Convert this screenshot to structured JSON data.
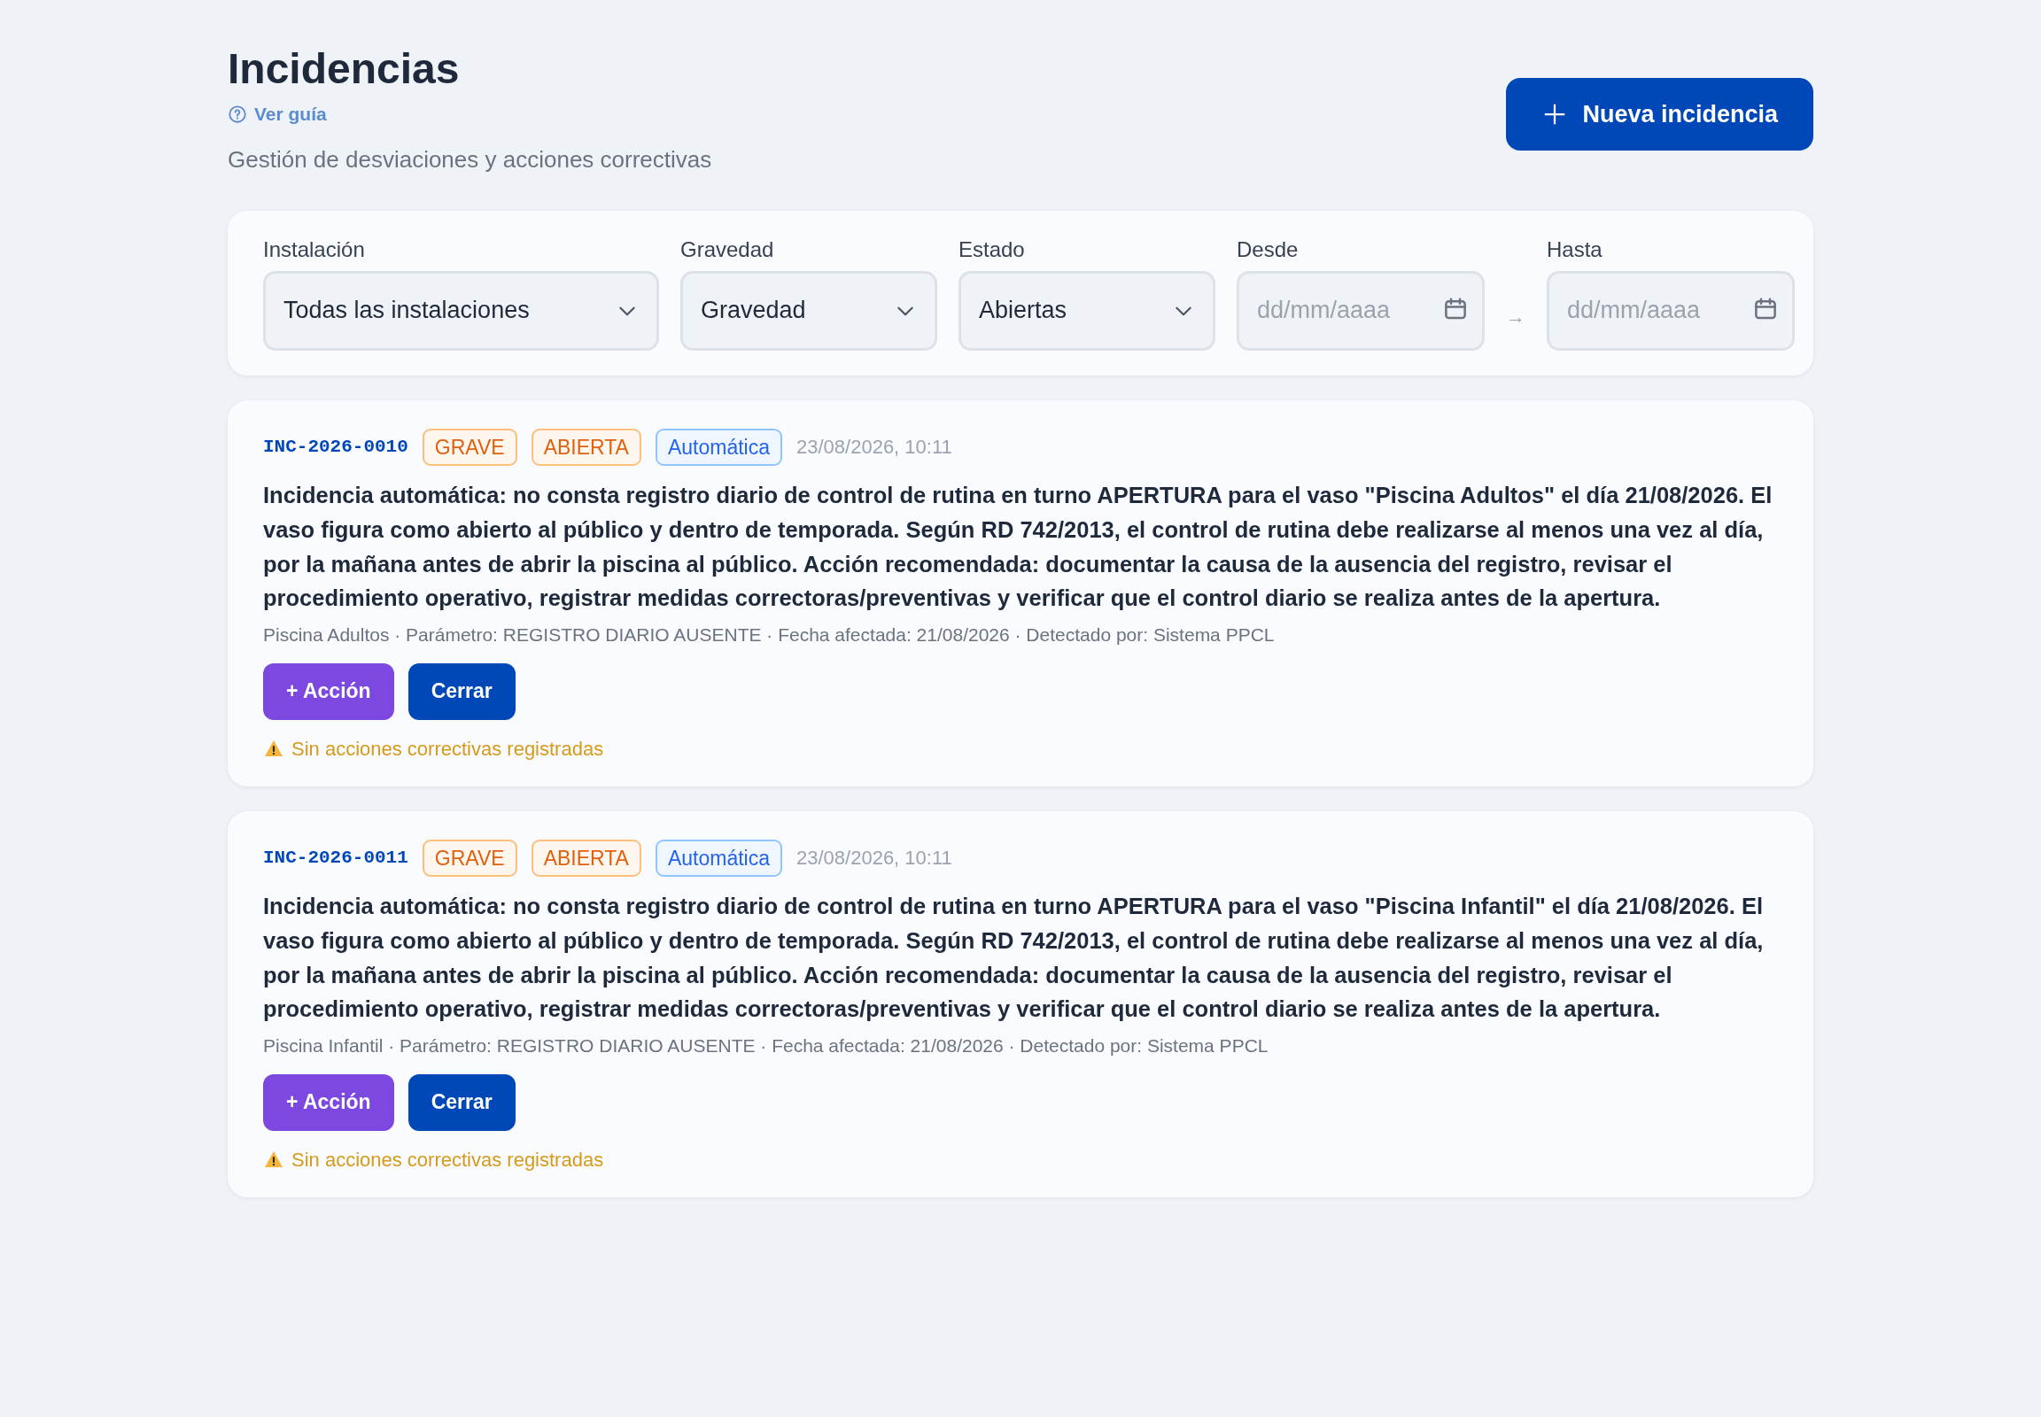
{
  "header": {
    "title": "Incidencias",
    "guide_link": "Ver guía",
    "subtitle": "Gestión de desviaciones y acciones correctivas",
    "new_button": "Nueva incidencia"
  },
  "filters": [
    {
      "kind": "select",
      "label": "Instalación",
      "value": "Todas las instalaciones"
    },
    {
      "kind": "select",
      "label": "Gravedad",
      "value": "Gravedad"
    },
    {
      "kind": "select",
      "label": "Estado",
      "value": "Abiertas"
    },
    {
      "kind": "date",
      "label": "Desde",
      "placeholder": "dd/mm/aaaa"
    },
    {
      "kind": "separator",
      "text": "→"
    },
    {
      "kind": "date",
      "label": "Hasta",
      "placeholder": "dd/mm/aaaa"
    }
  ],
  "incidents": [
    {
      "code": "INC-2026-0010",
      "severity": "GRAVE",
      "status": "ABIERTA",
      "origin": "Automática",
      "timestamp": "23/08/2026, 10:11",
      "description": "Incidencia automática: no consta registro diario de control de rutina en turno APERTURA para el vaso \"Piscina Adultos\" el día 21/08/2026. El vaso figura como abierto al público y dentro de temporada. Según RD 742/2013, el control de rutina debe realizarse al menos una vez al día, por la mañana antes de abrir la piscina al público. Acción recomendada: documentar la causa de la ausencia del registro, revisar el procedimiento operativo, registrar medidas correctoras/preventivas y verificar que el control diario se realiza antes de la apertura.",
      "meta": "Piscina Adultos · Parámetro: REGISTRO DIARIO AUSENTE · Fecha afectada: 21/08/2026 · Detectado por: Sistema PPCL",
      "action_button": "+ Acción",
      "close_button": "Cerrar",
      "warning": "Sin acciones correctivas registradas"
    },
    {
      "code": "INC-2026-0011",
      "severity": "GRAVE",
      "status": "ABIERTA",
      "origin": "Automática",
      "timestamp": "23/08/2026, 10:11",
      "description": "Incidencia automática: no consta registro diario de control de rutina en turno APERTURA para el vaso \"Piscina Infantil\" el día 21/08/2026. El vaso figura como abierto al público y dentro de temporada. Según RD 742/2013, el control de rutina debe realizarse al menos una vez al día, por la mañana antes de abrir la piscina al público. Acción recomendada: documentar la causa de la ausencia del registro, revisar el procedimiento operativo, registrar medidas correctoras/preventivas y verificar que el control diario se realiza antes de la apertura.",
      "meta": "Piscina Infantil · Parámetro: REGISTRO DIARIO AUSENTE · Fecha afectada: 21/08/2026 · Detectado por: Sistema PPCL",
      "action_button": "+ Acción",
      "close_button": "Cerrar",
      "warning": "Sin acciones correctivas registradas"
    }
  ]
}
